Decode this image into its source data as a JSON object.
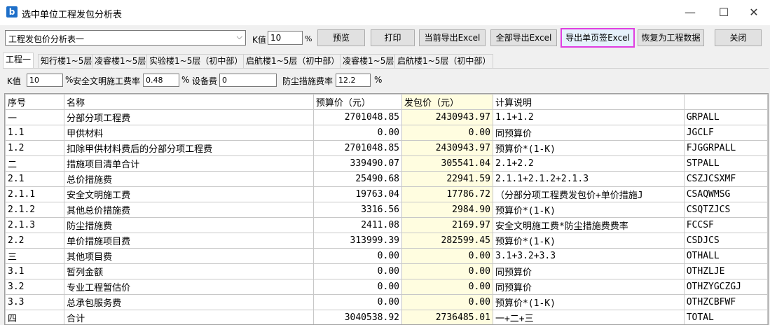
{
  "window": {
    "title": "选中单位工程发包分析表",
    "icon": "app-logo-icon",
    "min_label": "—",
    "max_label": "☐",
    "close_label": "✕"
  },
  "toolbar": {
    "combo_value": "工程发包价分析表一",
    "k_label": "K值",
    "k_value": "10",
    "pct": "%",
    "buttons": {
      "preview": "预览",
      "print": "打印",
      "export_current": "当前导出Excel",
      "export_all": "全部导出Excel",
      "export_single": "导出单页签Excel",
      "restore": "恢复为工程数据",
      "close": "关闭"
    }
  },
  "tabs": [
    "工程一",
    "知行楼1~5层",
    "凌睿楼1~5层",
    "实验楼1~5层（初中部）",
    "启航楼1~5层（初中部）",
    "凌睿楼1~5层",
    "启航楼1~5层（初中部）"
  ],
  "params": {
    "k_label": "K值",
    "k_value": "10",
    "safety_label": "安全文明施工费率",
    "safety_value": "0.48",
    "equip_label": "设备费",
    "equip_value": "0",
    "dust_label": "防尘措施费率",
    "dust_value": "12.2",
    "pct": "%"
  },
  "table": {
    "headers": [
      "序号",
      "名称",
      "预算价（元）",
      "发包价（元）",
      "计算说明",
      ""
    ],
    "rows": [
      [
        "一",
        "分部分项工程费",
        "2701048.85",
        "2430943.97",
        "1.1+1.2",
        "GRPALL"
      ],
      [
        "1.1",
        "甲供材料",
        "0.00",
        "0.00",
        "同预算价",
        "JGCLF"
      ],
      [
        "1.2",
        "扣除甲供材料费后的分部分项工程费",
        "2701048.85",
        "2430943.97",
        "预算价*(1-K)",
        "FJGGRPALL"
      ],
      [
        "二",
        "措施项目清单合计",
        "339490.07",
        "305541.04",
        "2.1+2.2",
        "STPALL"
      ],
      [
        "2.1",
        "总价措施费",
        "25490.68",
        "22941.59",
        "2.1.1+2.1.2+2.1.3",
        "CSZJCSXMF"
      ],
      [
        "2.1.1",
        "安全文明施工费",
        "19763.04",
        "17786.72",
        "（分部分项工程费发包价+单价措施J",
        "CSAQWMSG"
      ],
      [
        "2.1.2",
        "其他总价措施费",
        "3316.56",
        "2984.90",
        "预算价*(1-K)",
        "CSQTZJCS"
      ],
      [
        "2.1.3",
        "防尘措施费",
        "2411.08",
        "2169.97",
        "安全文明施工费*防尘措施费费率",
        "FCCSF"
      ],
      [
        "2.2",
        "单价措施项目费",
        "313999.39",
        "282599.45",
        "预算价*(1-K)",
        "CSDJCS"
      ],
      [
        "三",
        "其他项目费",
        "0.00",
        "0.00",
        "3.1+3.2+3.3",
        "OTHALL"
      ],
      [
        "3.1",
        "暂列金额",
        "0.00",
        "0.00",
        "同预算价",
        "OTHZLJE"
      ],
      [
        "3.2",
        "专业工程暂估价",
        "0.00",
        "0.00",
        "同预算价",
        "OTHZYGCZGJ"
      ],
      [
        "3.3",
        "总承包服务费",
        "0.00",
        "0.00",
        "预算价*(1-K)",
        "OTHZCBFWF"
      ],
      [
        "四",
        "合计",
        "3040538.92",
        "2736485.01",
        "一+二+三",
        "TOTAL"
      ]
    ]
  }
}
